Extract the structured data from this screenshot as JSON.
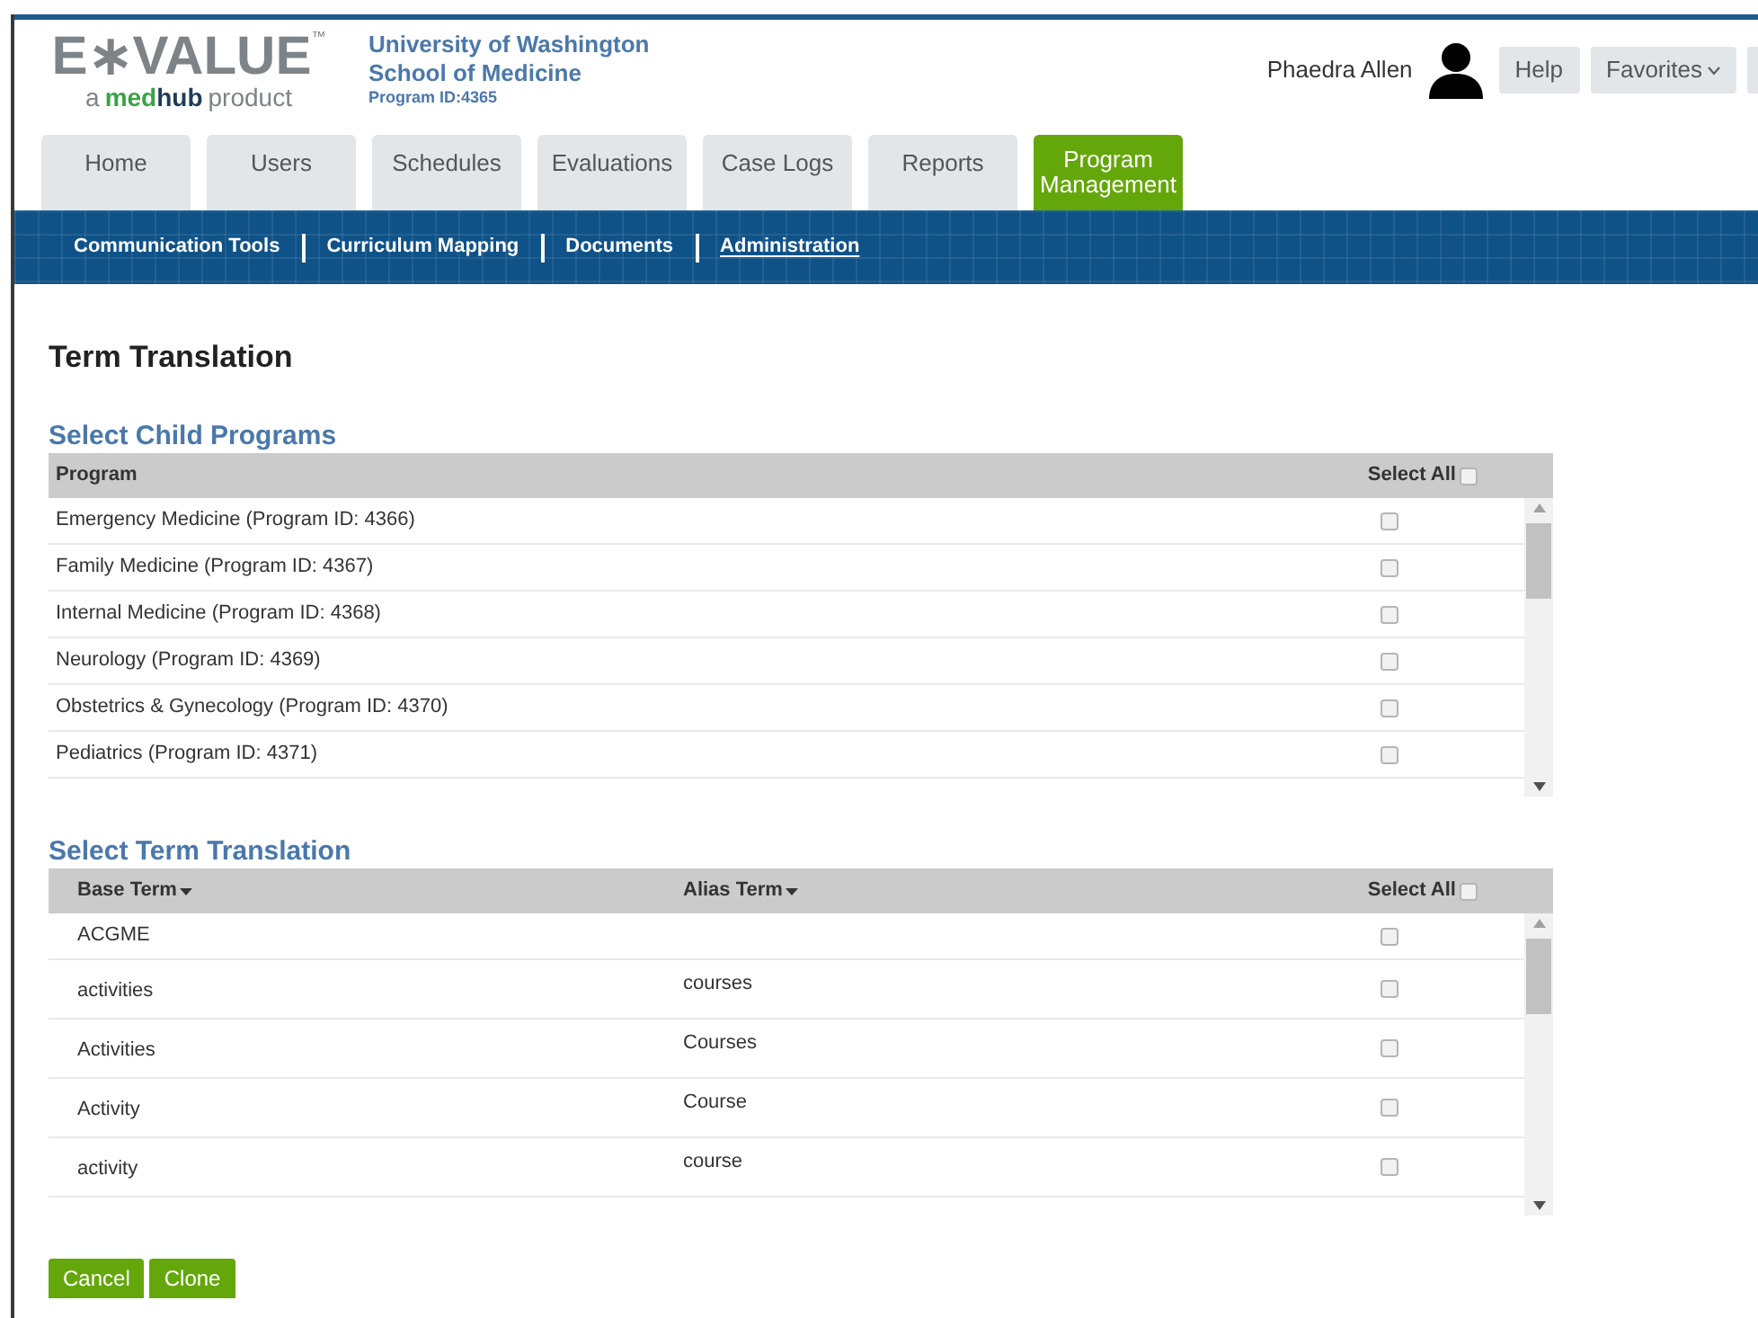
{
  "logo": {
    "wordmark": "E∗VALUE",
    "trademark": "™",
    "tagline_prefix": "a",
    "brand_part_1": "med",
    "brand_part_2": "hub",
    "tagline_suffix": "product"
  },
  "institution": {
    "line_1": "University of Washington",
    "line_2": "School of Medicine",
    "program_id": "Program ID:4365"
  },
  "user": {
    "name": "Phaedra Allen"
  },
  "header_buttons": [
    {
      "label": "Help",
      "kind": "plain"
    },
    {
      "label": "Favorites",
      "kind": "dropdown"
    }
  ],
  "tabs": [
    {
      "label": "Home",
      "selected": false
    },
    {
      "label": "Users",
      "selected": false
    },
    {
      "label": "Schedules",
      "selected": false
    },
    {
      "label": "Evaluations",
      "selected": false
    },
    {
      "label": "Case Logs",
      "selected": false
    },
    {
      "label": "Reports",
      "selected": false
    },
    {
      "label": "Program Management",
      "selected": true
    }
  ],
  "subnav": [
    {
      "label": "Communication Tools",
      "selected": false
    },
    {
      "label": "Curriculum Mapping",
      "selected": false
    },
    {
      "label": "Documents",
      "selected": false
    },
    {
      "label": "Administration",
      "selected": true
    }
  ],
  "page_title": "Term Translation",
  "child_programs": {
    "heading": "Select Child Programs",
    "column_program": "Program",
    "select_all": {
      "label": "Select All",
      "checked": false
    },
    "rows": [
      {
        "name": "Emergency Medicine (Program ID: 4366)",
        "checked": false
      },
      {
        "name": "Family Medicine (Program ID: 4367)",
        "checked": false
      },
      {
        "name": "Internal Medicine (Program ID: 4368)",
        "checked": false
      },
      {
        "name": "Neurology (Program ID: 4369)",
        "checked": false
      },
      {
        "name": "Obstetrics & Gynecology (Program ID: 4370)",
        "checked": false
      },
      {
        "name": "Pediatrics (Program ID: 4371)",
        "checked": false
      }
    ]
  },
  "term_translation": {
    "heading": "Select Term Translation",
    "column_base": "Base Term",
    "column_alias": "Alias Term",
    "select_all": {
      "label": "Select All",
      "checked": false
    },
    "rows": [
      {
        "base": "ACGME",
        "alias": "",
        "checked": false
      },
      {
        "base": "activities",
        "alias": "courses",
        "checked": false
      },
      {
        "base": "Activities",
        "alias": "Courses",
        "checked": false
      },
      {
        "base": "Activity",
        "alias": "Course",
        "checked": false
      },
      {
        "base": "activity",
        "alias": "course",
        "checked": false
      }
    ]
  },
  "buttons": [
    "Cancel",
    "Clone"
  ]
}
